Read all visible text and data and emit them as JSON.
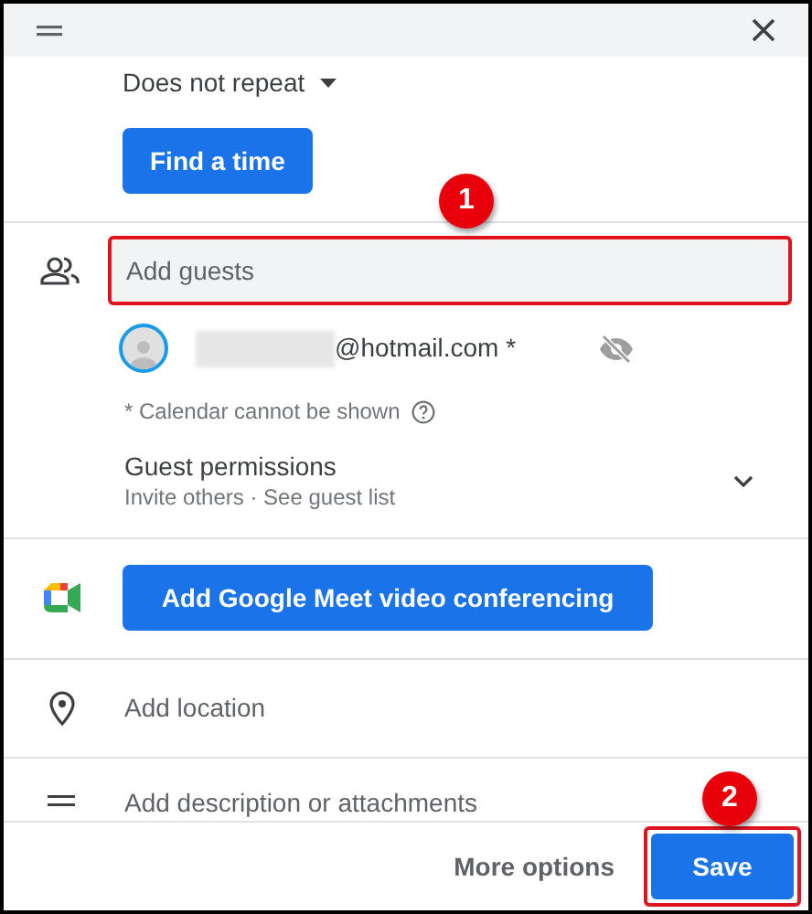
{
  "recurrence": {
    "label": "Does not repeat"
  },
  "find_time_button": {
    "label": "Find a time"
  },
  "guests": {
    "placeholder": "Add guests",
    "highlighted": true,
    "callout": "1",
    "list": [
      {
        "email": "@hotmail.com *",
        "redacted": true
      }
    ],
    "calendar_note": "* Calendar cannot be shown",
    "permissions": {
      "title": "Guest permissions",
      "subtitle": "Invite others · See guest list"
    }
  },
  "meet_button": {
    "label": "Add Google Meet video conferencing"
  },
  "location": {
    "placeholder": "Add location"
  },
  "description": {
    "placeholder": "Add description or attachments"
  },
  "footer": {
    "more_options": "More options",
    "save": {
      "label": "Save",
      "highlighted": true,
      "callout": "2"
    }
  }
}
